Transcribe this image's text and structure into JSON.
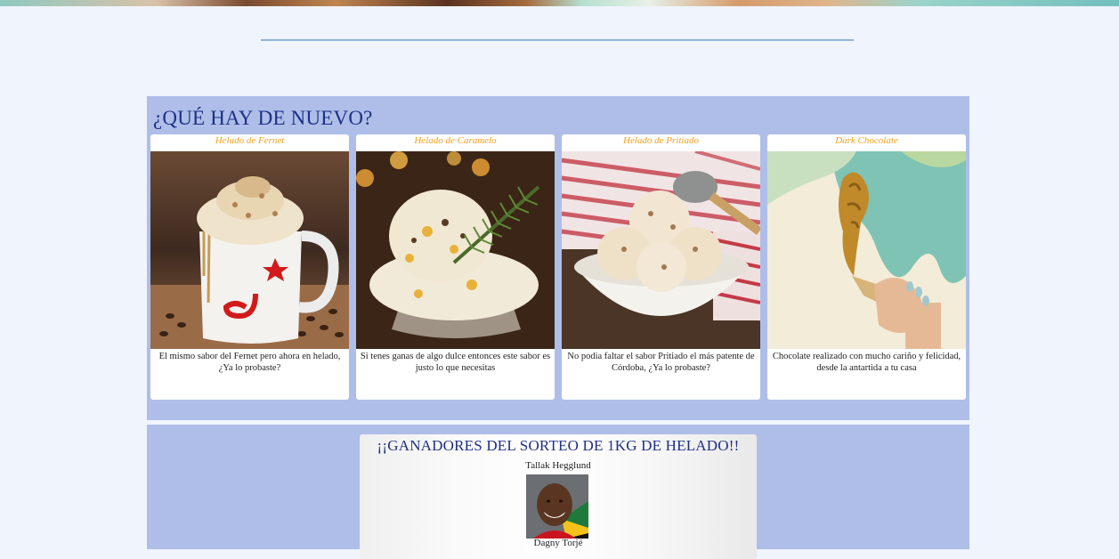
{
  "colors": {
    "page_bg": "#eff4fd",
    "section_bg": "#aebee8",
    "heading": "#1f2f86",
    "card_title": "#f2a11c",
    "rule": "#91b5d9"
  },
  "news": {
    "title": "¿QUÉ HAY DE NUEVO?",
    "cards": [
      {
        "title": "Helado de Fernet",
        "image_icon": "fernet-ice-cream-mug-image",
        "description": "El mismo sabor del Fernet pero ahora en helado, ¿Ya lo probaste?"
      },
      {
        "title": "Helado de Caramelo",
        "image_icon": "caramel-ice-cream-glass-image",
        "description": "Si tenes ganas de algo dulce entonces este sabor es justo lo que necesitas"
      },
      {
        "title": "Helado de Pritiado",
        "image_icon": "pritiado-ice-cream-bowl-image",
        "description": "No podia faltar el sabor Pritiado el más patente de Córdoba, ¿Ya lo probaste?"
      },
      {
        "title": "Dark Chocolate",
        "image_icon": "chocolate-cone-image",
        "description": "Chocolate realizado con mucho cariño y felicidad, desde la antartida a tu casa"
      }
    ]
  },
  "raffle": {
    "title": "¡¡GANADORES DEL SORTEO DE 1KG DE HELADO!!",
    "winners": [
      {
        "name": "Tallak Hegglund",
        "photo_icon": "winner-avatar-image"
      },
      {
        "name": "Dagny Torjé"
      }
    ]
  }
}
